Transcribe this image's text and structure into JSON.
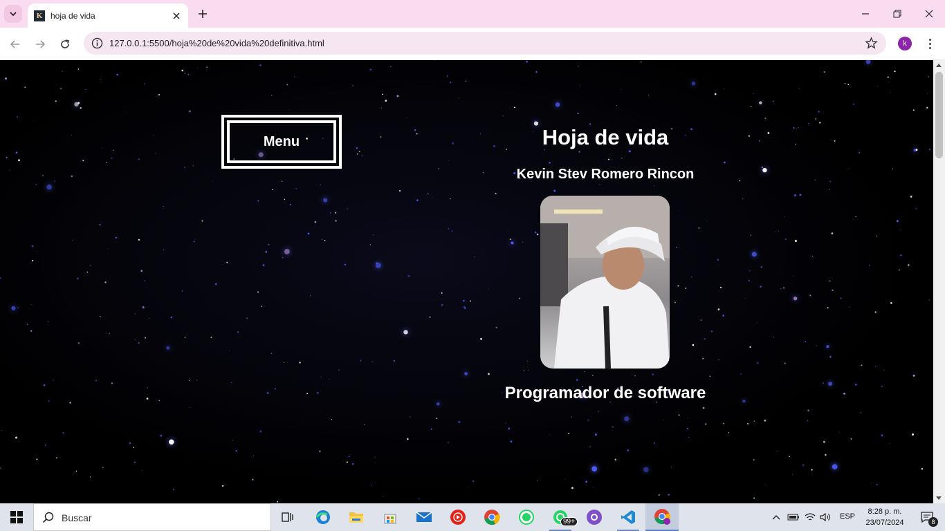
{
  "browser": {
    "tab": {
      "title": "hoja de vida",
      "favicon_letter": "K"
    },
    "url": "127.0.0.1:5500/hoja%20de%20vida%20definitiva.html",
    "profile_initial": "k",
    "icons": {
      "tab_search": "chevron-down-icon",
      "close": "close-icon",
      "new_tab": "plus-icon",
      "minimize": "minimize-icon",
      "restore": "restore-icon",
      "window_close": "close-icon",
      "back": "arrow-left-icon",
      "forward": "arrow-right-icon",
      "reload": "reload-icon",
      "site_info": "info-icon",
      "bookmark": "star-icon",
      "menu": "more-vertical-icon"
    }
  },
  "page": {
    "menu_label": "Menu",
    "title": "Hoja de vida",
    "name": "Kevin Stev Romero Rincon",
    "role": "Programador de software",
    "background_color": "#000000",
    "text_color": "#ffffff"
  },
  "taskbar": {
    "search_placeholder": "Buscar",
    "apps": [
      {
        "name": "task-view"
      },
      {
        "name": "edge"
      },
      {
        "name": "file-explorer"
      },
      {
        "name": "microsoft-store"
      },
      {
        "name": "mail"
      },
      {
        "name": "youtube-music"
      },
      {
        "name": "chrome"
      },
      {
        "name": "whatsapp"
      },
      {
        "name": "whatsapp-business",
        "badge": "99+"
      },
      {
        "name": "github-desktop"
      },
      {
        "name": "vscode"
      },
      {
        "name": "chrome-profile"
      }
    ],
    "language": "ESP",
    "time": "8:28 p. m.",
    "date": "23/07/2024",
    "notifications_count": "8"
  }
}
